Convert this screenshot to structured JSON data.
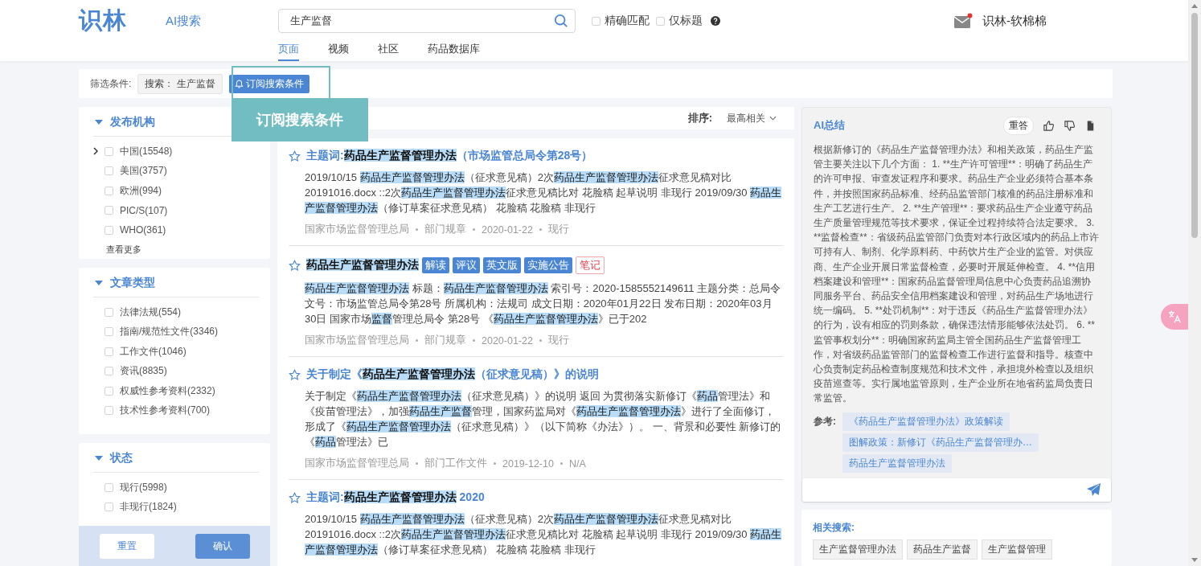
{
  "header": {
    "logo": "识林",
    "ai_link": "AI搜索",
    "search": {
      "value": "生产监督"
    },
    "options": [
      {
        "label": "精确匹配",
        "checked": false
      },
      {
        "label": "仅标题",
        "checked": false
      }
    ],
    "tabs": [
      {
        "label": "页面",
        "selected": true
      },
      {
        "label": "视频",
        "selected": false
      },
      {
        "label": "社区",
        "selected": false
      },
      {
        "label": "药品数据库",
        "selected": false
      }
    ],
    "mail": {
      "unread": true
    },
    "user": "识林-软棉棉"
  },
  "filter_bar": {
    "label": "筛选条件:",
    "chip": "搜索： 生产监督",
    "subscribe_button": "订阅搜索条件",
    "tooltip": "订阅搜索条件"
  },
  "facets": [
    {
      "title": "发布机构",
      "expanded": true,
      "items": [
        {
          "label": "中国(15548)",
          "checked": false,
          "has_children": true
        },
        {
          "label": "美国(3757)",
          "checked": false,
          "has_children": false
        },
        {
          "label": "欧洲(994)",
          "checked": false,
          "has_children": false
        },
        {
          "label": "PIC/S(107)",
          "checked": false,
          "has_children": false
        },
        {
          "label": "WHO(361)",
          "checked": false,
          "has_children": false
        }
      ],
      "more": "查看更多"
    },
    {
      "title": "文章类型",
      "expanded": true,
      "items": [
        {
          "label": "法律法规(554)",
          "checked": false,
          "has_children": false
        },
        {
          "label": "指南/规范性文件(3346)",
          "checked": false,
          "has_children": false
        },
        {
          "label": "工作文件(1046)",
          "checked": false,
          "has_children": false
        },
        {
          "label": "资讯(8835)",
          "checked": false,
          "has_children": false
        },
        {
          "label": "权威性参考资料(2332)",
          "checked": false,
          "has_children": false
        },
        {
          "label": "技术性参考资料(700)",
          "checked": false,
          "has_children": false
        }
      ]
    },
    {
      "title": "状态",
      "expanded": true,
      "items": [
        {
          "label": "现行(5998)",
          "checked": false,
          "has_children": false
        },
        {
          "label": "非现行(1824)",
          "checked": false,
          "has_children": false
        }
      ]
    }
  ],
  "facet_buttons": {
    "reset": "重置",
    "confirm": "确认"
  },
  "sort": {
    "label": "排序:",
    "value": "最高相关"
  },
  "results": [
    {
      "starred": false,
      "title": [
        {
          "text": "主题词:",
          "highlighted": false
        },
        {
          "text": "药品生产监督管理办法",
          "highlighted": true
        },
        {
          "text": "（市场监管总局令第28号）",
          "highlighted": false
        }
      ],
      "snippet": [
        {
          "text": "2019/10/15 ",
          "highlighted": false
        },
        {
          "text": "药品生产监督管理办法",
          "highlighted": true
        },
        {
          "text": "（征求意见稿）2次",
          "highlighted": false
        },
        {
          "text": "药品生产监督管理办法",
          "highlighted": true
        },
        {
          "text": "征求意见稿对比 20191016.docx ::2次",
          "highlighted": false
        },
        {
          "text": "药品生产监督管理办法",
          "highlighted": true
        },
        {
          "text": "征求意见稿比对 花脸稿 起草说明 非现行 2019/09/30 ",
          "highlighted": false
        },
        {
          "text": "药品生产监督管理办法",
          "highlighted": true
        },
        {
          "text": "（修订草案征求意见稿） 花脸稿 花脸稿 非现行",
          "highlighted": false
        }
      ],
      "meta": [
        "国家市场监督管理总局",
        "部门规章",
        "2020-01-22",
        "现行"
      ]
    },
    {
      "starred": false,
      "title": [
        {
          "text": "药品生产监督管理办法",
          "highlighted": true
        }
      ],
      "tags": [
        {
          "label": "解读",
          "kind": "label"
        },
        {
          "label": "评议",
          "kind": "label"
        },
        {
          "label": "英文版",
          "kind": "label"
        },
        {
          "label": "实施公告",
          "kind": "label"
        },
        {
          "label": "笔记",
          "kind": "note"
        }
      ],
      "snippet": [
        {
          "text": "药品生产监督管理办法",
          "highlighted": true
        },
        {
          "text": " 标题：",
          "highlighted": false
        },
        {
          "text": "药品生产监督管理办法",
          "highlighted": true
        },
        {
          "text": " 索引号：2020-1585552149611 主题分类：总局令文号：市场监管总局令第28号 所属机构：法规司 成文日期：2020年01月22日 发布日期：2020年03月30日 国家市场",
          "highlighted": false
        },
        {
          "text": "监督",
          "highlighted": true
        },
        {
          "text": "管理总局令 第28号 《",
          "highlighted": false
        },
        {
          "text": "药品生产监督管理办法",
          "highlighted": true
        },
        {
          "text": "》已于202",
          "highlighted": false
        }
      ],
      "meta": [
        "国家市场监督管理总局",
        "部门规章",
        "2020-01-22",
        "现行"
      ]
    },
    {
      "starred": false,
      "title": [
        {
          "text": "关于制定《",
          "highlighted": false
        },
        {
          "text": "药品生产监督管理办法",
          "highlighted": true
        },
        {
          "text": "（征求意见稿）》的说明",
          "highlighted": false
        }
      ],
      "snippet": [
        {
          "text": "关于制定《",
          "highlighted": false
        },
        {
          "text": "药品生产监督管理办法",
          "highlighted": true
        },
        {
          "text": "（征求意见稿）》的说明 返回 为贯彻落实新修订《",
          "highlighted": false
        },
        {
          "text": "药品",
          "highlighted": true
        },
        {
          "text": "管理法》和《疫苗管理法》，加强",
          "highlighted": false
        },
        {
          "text": "药品生产监督",
          "highlighted": true
        },
        {
          "text": "管理，国家药监局对《",
          "highlighted": false
        },
        {
          "text": "药品生产监督管理办法",
          "highlighted": true
        },
        {
          "text": "》进行了全面修订，形成了《",
          "highlighted": false
        },
        {
          "text": "药品生产监督管理办法",
          "highlighted": true
        },
        {
          "text": "（征求意见稿）》（以下简称《办法》）。 一、背景和必要性 新修订的《",
          "highlighted": false
        },
        {
          "text": "药品",
          "highlighted": true
        },
        {
          "text": "管理法》已",
          "highlighted": false
        }
      ],
      "meta": [
        "国家市场监督管理总局",
        "部门工作文件",
        "2019-12-10",
        "N/A"
      ]
    },
    {
      "starred": false,
      "title": [
        {
          "text": "主题词:",
          "highlighted": false
        },
        {
          "text": "药品生产监督管理办法",
          "highlighted": true
        },
        {
          "text": " 2020",
          "highlighted": false
        }
      ],
      "snippet": [
        {
          "text": "2019/10/15 ",
          "highlighted": false
        },
        {
          "text": "药品生产监督管理办法",
          "highlighted": true
        },
        {
          "text": "（征求意见稿）2次",
          "highlighted": false
        },
        {
          "text": "药品生产监督管理办法",
          "highlighted": true
        },
        {
          "text": "征求意见稿对比 20191016.docx ::2次",
          "highlighted": false
        },
        {
          "text": "药品生产监督管理办法",
          "highlighted": true
        },
        {
          "text": "征求意见稿比对 花脸稿 起草说明 非现行 2019/09/30 ",
          "highlighted": false
        },
        {
          "text": "药品生产监督管理办法",
          "highlighted": true
        },
        {
          "text": "（修订草案征求意见稿） 花脸稿 花脸稿 非现行",
          "highlighted": false
        }
      ]
    }
  ],
  "ai_summary": {
    "title": "AI总结",
    "regenerate": "重答",
    "text": "根据新修订的《药品生产监督管理办法》和相关政策，药品生产监管主要关注以下几个方面： 1. **生产许可管理**：明确了药品生产的许可申报、审查发证程序和要求。药品生产企业必须符合基本条件，并按照国家药品标准、经药品监管部门核准的药品注册标准和生产工艺进行生产。 2. **生产管理**：要求药品生产企业遵守药品生产质量管理规范等技术要求，保证全过程持续符合法定要求。 3. **监督检查**：省级药品监管部门负责对本行政区域内的药品上市许可持有人、制剂、化学原料药、中药饮片生产企业的监管。对供应商、生产企业开展日常监督检查，必要时开展延伸检查。 4. **信用档案建设和管理**：国家药品监督管理局信息中心负责药品追溯协同服务平台、药品安全信用档案建设和管理，对药品生产场地进行统一编码。 5. **处罚机制**：对于违反《药品生产监督管理办法》的行为，设有相应的罚则条款，确保违法情形能够依法处罚。 6. **监管事权划分**：明确国家药监局主管全国药品生产监督管理工作，对省级药品监管部门的监督检查工作进行监督和指导。核查中心负责制定药品检查制度规范和技术文件，承担境外检查以及组织疫苗巡查等。实行属地监管原则，生产企业所在地省药监局负责日常监管。",
    "references_label": "参考:",
    "references": [
      "《药品生产监督管理办法》政策解读",
      "图解政策：新修订《药品生产监督管理办…",
      "药品生产监督管理办法"
    ]
  },
  "related": {
    "title": "相关搜索:",
    "items": [
      "生产监督管理办法",
      "药品生产监督",
      "生产监督管理"
    ]
  }
}
